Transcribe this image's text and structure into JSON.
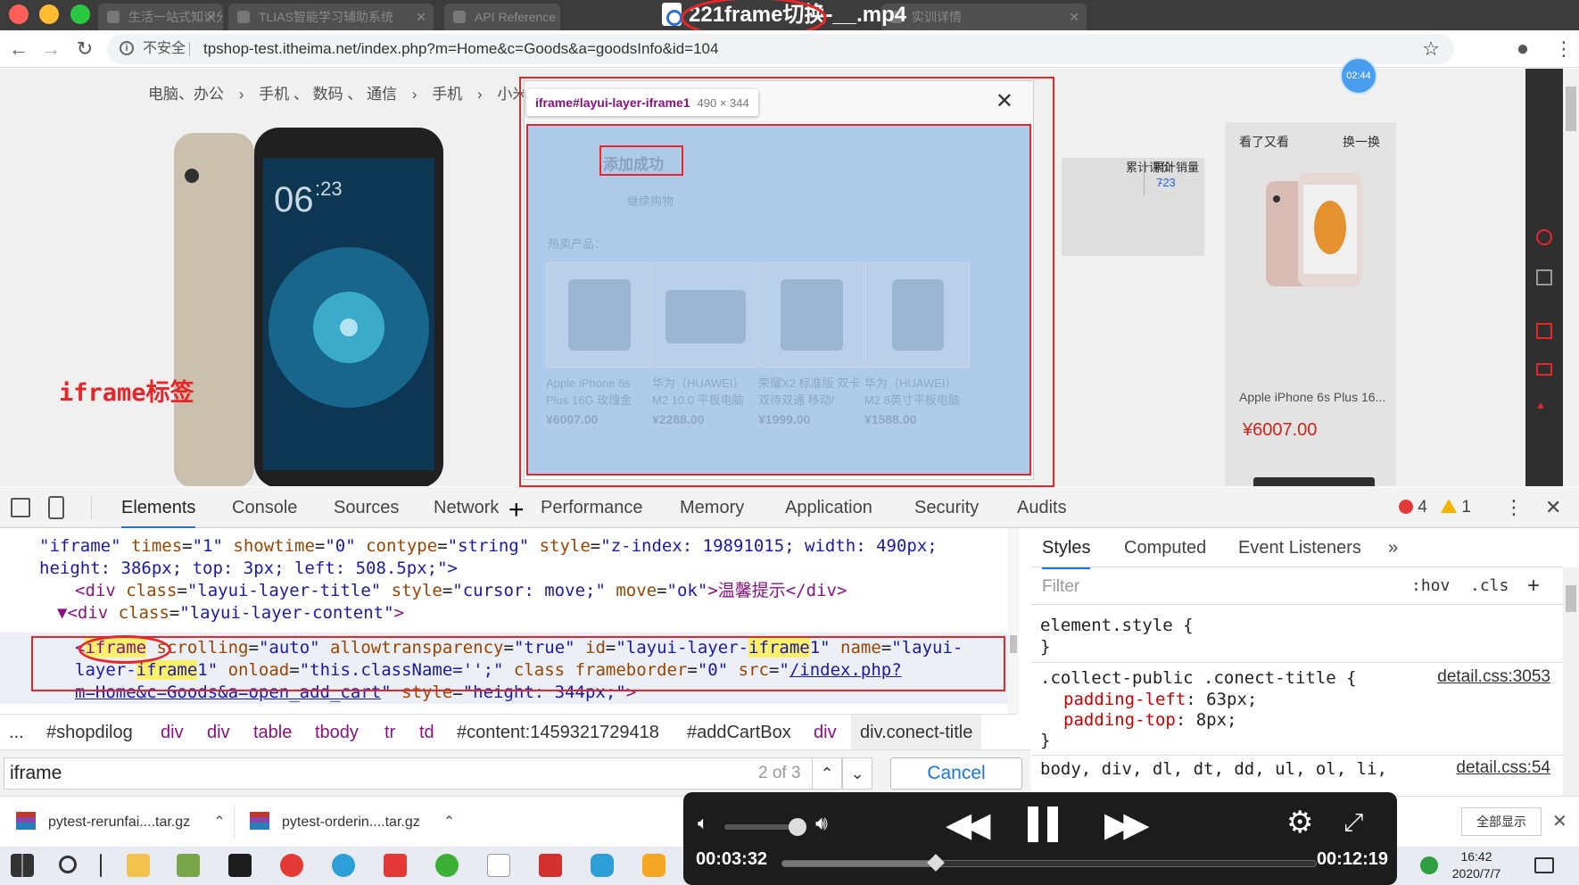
{
  "browser": {
    "tabs": [
      "生活一站式知识分享平台",
      "TLIAS智能学习辅助系统",
      "API Reference",
      "实训详情"
    ],
    "video_title": "221frame切换-__.mp4",
    "insecure_label": "不安全",
    "url": "tpshop-test.itheima.net/index.php?m=Home&c=Goods&a=goodsInfo&id=104"
  },
  "page": {
    "breadcrumb": [
      "电脑、办公",
      "›",
      "手机 、 数码 、 通信",
      "›",
      "手机",
      "›",
      "小米手机"
    ],
    "stats": {
      "reviews_label": "累计评价",
      "reviews": "7",
      "sales_label": "累计销量",
      "sales": "-23"
    },
    "related": {
      "title": "看了又看",
      "swap": "换一换",
      "product_name": "Apple iPhone 6s Plus 16...",
      "product_price": "¥6007.00"
    },
    "timer_badge": "02:44",
    "annotation": "iframe标签",
    "tooltip": {
      "tag": "iframe#layui-layer-iframe1",
      "size": "490 × 344"
    },
    "layer": {
      "close": "✕",
      "success": "添加成功",
      "continue": "继续购物",
      "hot_label": "热卖产品：",
      "hot_products": [
        {
          "name": "Apple iPhone 6s Plus 16G 玫瑰金",
          "price": "¥6007.00"
        },
        {
          "name": "华为（HUAWEI）M2 10.0 平板电脑",
          "price": "¥2288.00"
        },
        {
          "name": "荣耀X2 标准版 双卡双待双通 移动/",
          "price": "¥1999.00"
        },
        {
          "name": "华为（HUAWEI）M2 8英寸平板电脑",
          "price": "¥1588.00"
        }
      ]
    }
  },
  "devtools": {
    "tabs": [
      "Elements",
      "Console",
      "Sources",
      "Network",
      "Performance",
      "Memory",
      "Application",
      "Security",
      "Audits"
    ],
    "errors": "4",
    "warnings": "1",
    "code": {
      "l1": [
        "\"iframe\"",
        " times",
        "=",
        "\"1\"",
        " showtime",
        "=",
        "\"0\"",
        " contype",
        "=",
        "\"string\"",
        " style",
        "=",
        "\"z-index: 19891015; width: 490px;"
      ],
      "l2": "height: 386px; top: 3px; left: 508.5px;\">",
      "l3_pre": "<div",
      "l3_attr1": " class",
      "l3_val1": "\"layui-layer-title\"",
      "l3_attr2": " style",
      "l3_val2": "\"cursor: move;\"",
      "l3_attr3": " move",
      "l3_val3": "\"ok\"",
      "l3_text": ">温馨提示</div>",
      "l4_tag": "▼<div",
      "l4_attr": " class",
      "l4_val": "\"layui-layer-content\"",
      "l4_end": ">",
      "l5": [
        "<",
        "iframe",
        " scrolling",
        "=",
        "\"auto\"",
        " allowtransparency",
        "=",
        "\"true\"",
        " id",
        "=",
        "\"layui-layer-",
        "iframe",
        "1\"",
        " name",
        "=",
        "\"layui-"
      ],
      "l6": [
        "layer-",
        "iframe",
        "1\"",
        " onload",
        "=",
        "\"this.className='';\"",
        " class",
        " frameborder",
        "=",
        "\"0\"",
        " src",
        "=",
        "\"",
        "/index.php?"
      ],
      "l7": [
        "m=Home&c=Goods&a=open_add_cart",
        "\"",
        " style",
        "=",
        "\"height: 344px;\"",
        ">"
      ]
    },
    "breadcrumbs": [
      "...",
      "#shopdilog",
      "div",
      "div",
      "table",
      "tbody",
      "tr",
      "td",
      "#content:1459321729418",
      "#addCartBox",
      "div",
      "div.conect-title"
    ],
    "find": {
      "value": "iframe",
      "count": "2 of 3",
      "cancel": "Cancel",
      "up": "⌃",
      "down": "⌄"
    },
    "styles": {
      "tabs": [
        "Styles",
        "Computed",
        "Event Listeners",
        "»"
      ],
      "filter": "Filter",
      "hov": ":hov",
      "cls": ".cls",
      "plus": "+",
      "rule1_selector": "element.style {",
      "rule1_close": "}",
      "rule2_selector": ".collect-public .conect-title {",
      "rule2_source": "detail.css:3053",
      "rule2_p1_name": "padding-left",
      "rule2_p1_value": ": 63px;",
      "rule2_p2_name": "padding-top",
      "rule2_p2_value": ": 8px;",
      "rule2_close": "}",
      "rule3_selector": "body, div, dl, dt, dd, ul, ol, li,",
      "rule3_source": "detail.css:54"
    }
  },
  "downloads": {
    "items": [
      "pytest-rerunfai....tar.gz",
      "pytest-orderin....tar.gz"
    ],
    "show_all": "全部显示"
  },
  "player": {
    "current_time": "00:03:32",
    "total_time": "00:12:19",
    "progress": 0.287
  },
  "taskbar": {
    "time": "16:42",
    "date": "2020/7/7"
  }
}
